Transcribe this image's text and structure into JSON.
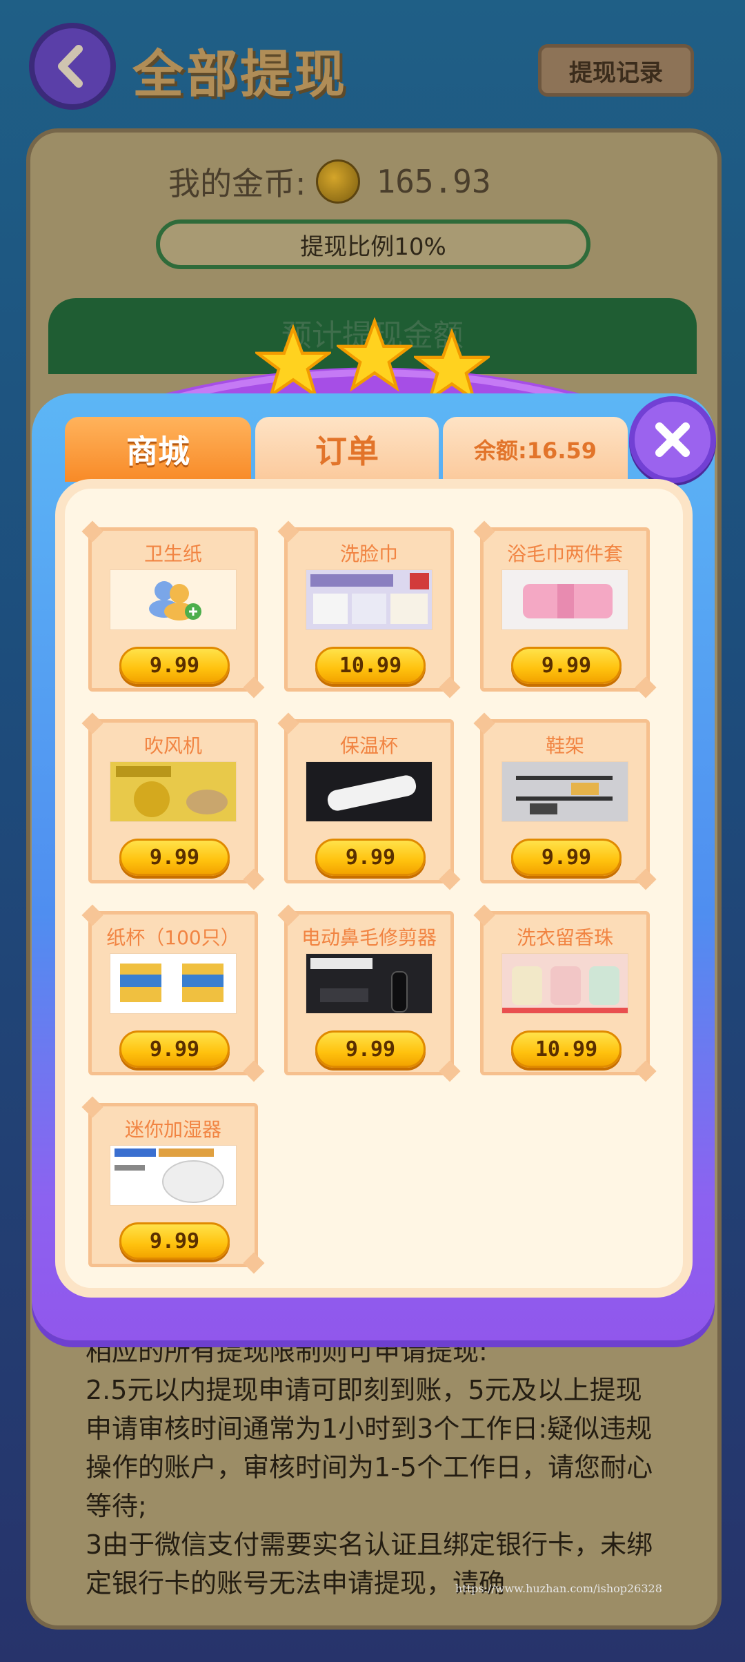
{
  "header": {
    "title": "全部提现",
    "history_button": "提现记录"
  },
  "wallet": {
    "label": "我的金币:",
    "amount": "165.93",
    "ratio": "提现比例10%",
    "estimate_label": "预计提现金额"
  },
  "modal": {
    "tabs": {
      "shop": "商城",
      "orders": "订单",
      "balance": "余额:16.59"
    },
    "products": [
      {
        "name": "卫生纸",
        "price": "9.99",
        "image": "user-add-icon"
      },
      {
        "name": "洗脸巾",
        "price": "10.99",
        "image": "face-towel-photo"
      },
      {
        "name": "浴毛巾两件套",
        "price": "9.99",
        "image": "bath-towel-photo"
      },
      {
        "name": "吹风机",
        "price": "9.99",
        "image": "hair-dryer-photo"
      },
      {
        "name": "保温杯",
        "price": "9.99",
        "image": "thermos-photo"
      },
      {
        "name": "鞋架",
        "price": "9.99",
        "image": "shoe-rack-photo"
      },
      {
        "name": "纸杯（100只）",
        "price": "9.99",
        "image": "paper-cup-photo"
      },
      {
        "name": "电动鼻毛修剪器",
        "price": "9.99",
        "image": "nose-trimmer-photo"
      },
      {
        "name": "洗衣留香珠",
        "price": "10.99",
        "image": "laundry-beads-photo"
      },
      {
        "name": "迷你加湿器",
        "price": "9.99",
        "image": "humidifier-photo"
      }
    ]
  },
  "rules": {
    "line1": "相应的所有提现限制则可申请提现:",
    "line2": "  2.5元以内提现申请可即刻到账，5元及以上提现申请审核时间通常为1小时到3个工作日:疑似违规操作的账户，审核时间为1-5个工作日，请您耐心等待;",
    "line3": "  3由于微信支付需要实名认证且绑定银行卡，未绑定银行卡的账号无法申请提现，请确"
  },
  "watermark": "https://www.huzhan.com/ishop26328",
  "colors": {
    "accent_orange": "#f88a27",
    "price_yellow": "#ffc20e",
    "modal_blue": "#5cb6f5",
    "modal_purple": "#9157ec"
  }
}
